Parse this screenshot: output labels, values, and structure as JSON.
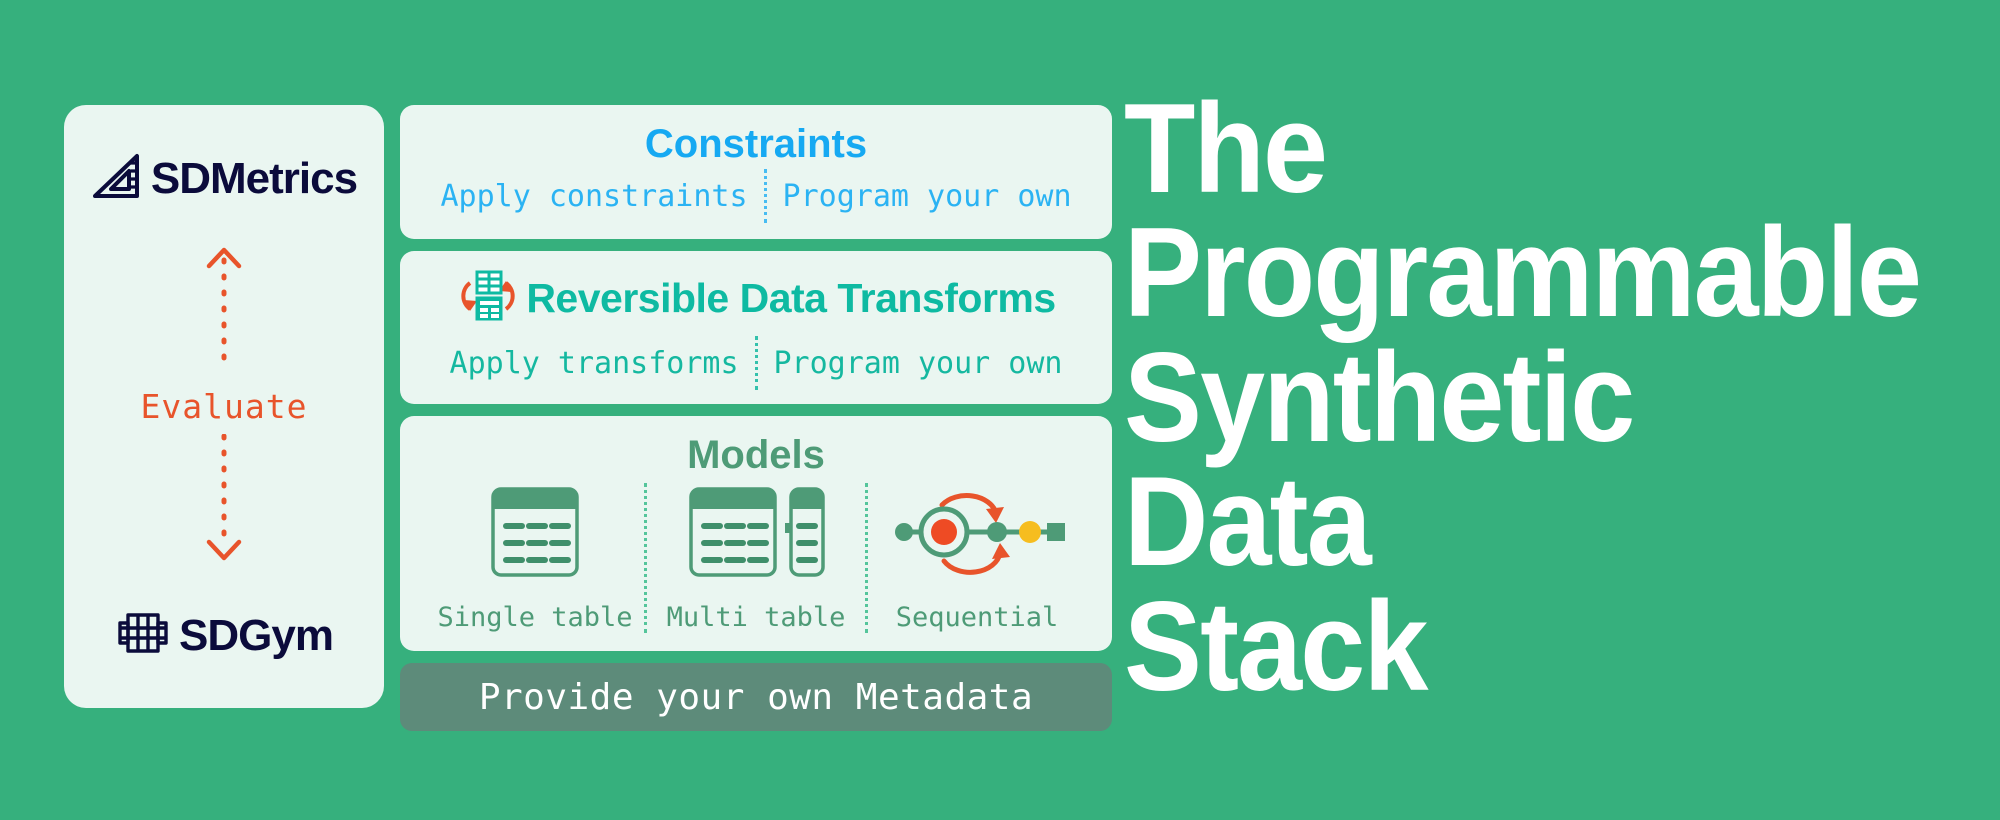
{
  "colors": {
    "background": "#36b07d",
    "card_bg": "#eaf6f1",
    "metadata_bar": "#5d8b7a",
    "navy": "#0b0b3b",
    "orange": "#e8542b",
    "constraints_blue": "#16a9f2",
    "rdt_teal": "#0ebaa2",
    "models_green": "#4e9b77",
    "yellow": "#f6bd1f",
    "headline_white": "#ffffff"
  },
  "left_panel": {
    "top_logo": {
      "icon": "triangle-ruler-icon",
      "label": "SDMetrics"
    },
    "connector": {
      "up_arrow": "arrow-up-dotted-icon",
      "label": "Evaluate",
      "down_arrow": "arrow-down-dotted-icon"
    },
    "bottom_logo": {
      "icon": "dumbbell-grid-icon",
      "label": "SDGym"
    }
  },
  "cards": {
    "constraints": {
      "title": "Constraints",
      "options": [
        "Apply constraints",
        "Program your own"
      ]
    },
    "reversible_data_transforms": {
      "icon": "reversible-tables-icon",
      "title": "Reversible Data Transforms",
      "options": [
        "Apply transforms",
        "Program your own"
      ]
    },
    "models": {
      "title": "Models",
      "items": [
        {
          "icon": "single-table-icon",
          "label": "Single table"
        },
        {
          "icon": "multi-table-icon",
          "label": "Multi table"
        },
        {
          "icon": "sequential-icon",
          "label": "Sequential"
        }
      ]
    }
  },
  "metadata_bar": {
    "label": "Provide your own Metadata"
  },
  "headline": {
    "lines": [
      "The",
      "Programmable",
      "Synthetic",
      "Data",
      "Stack"
    ]
  }
}
